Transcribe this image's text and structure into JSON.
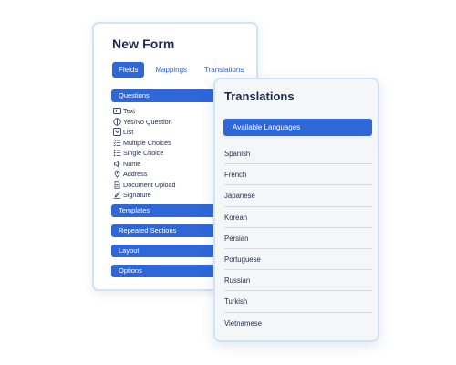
{
  "form": {
    "title": "New Form",
    "tabs": [
      {
        "label": "Fields",
        "active": true
      },
      {
        "label": "Mappings",
        "active": false
      },
      {
        "label": "Translations",
        "active": false
      }
    ],
    "sections": {
      "questions": "Questions",
      "templates": "Templates",
      "repeated": "Repeated Sections",
      "layout": "Layout",
      "options": "Options"
    },
    "fields": [
      {
        "label": "Text",
        "icon": "text-field-icon"
      },
      {
        "label": "Yes/No Question",
        "icon": "yes-no-icon"
      },
      {
        "label": "List",
        "icon": "list-icon"
      },
      {
        "label": "Multiple Choices",
        "icon": "multiple-choices-icon"
      },
      {
        "label": "Single Choice",
        "icon": "single-choice-icon"
      },
      {
        "label": "Name",
        "icon": "name-icon"
      },
      {
        "label": "Address",
        "icon": "location-pin-icon"
      },
      {
        "label": "Document Upload",
        "icon": "document-icon"
      },
      {
        "label": "Signature",
        "icon": "signature-icon"
      }
    ]
  },
  "translations": {
    "title": "Translations",
    "header": "Available Languages",
    "languages": [
      "Spanish",
      "French",
      "Japanese",
      "Korean",
      "Persian",
      "Portuguese",
      "Russian",
      "Turkish",
      "Vietnamese"
    ]
  },
  "colors": {
    "accent": "#2f66d8",
    "card_border": "#cfe4fb",
    "title_text": "#1d2b4f",
    "panel_bg": "#f5f6f7"
  }
}
